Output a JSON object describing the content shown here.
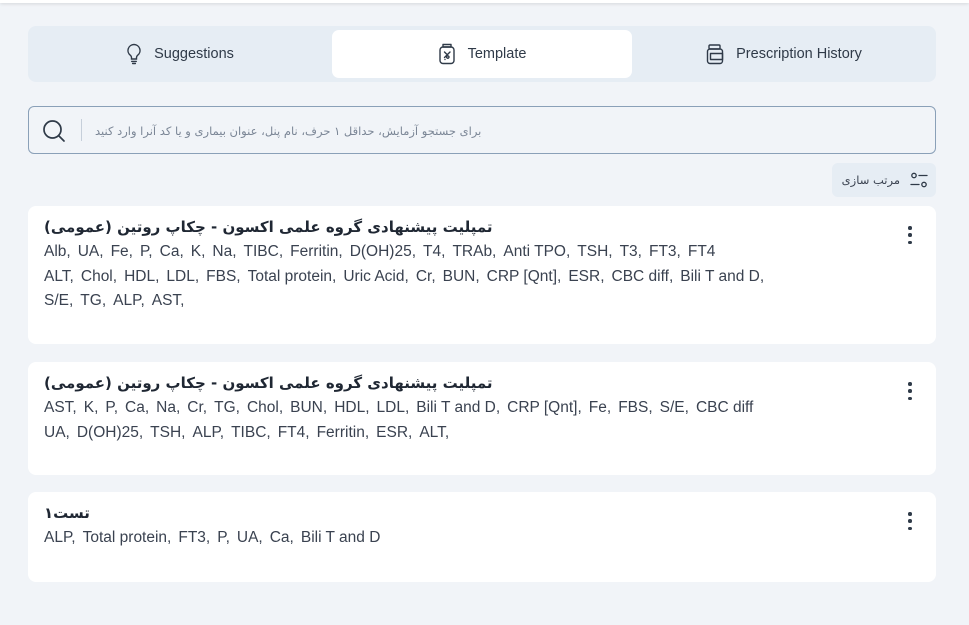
{
  "tabs": [
    {
      "label": "Suggestions",
      "icon": "lightbulb-icon",
      "active": false
    },
    {
      "label": "Template",
      "icon": "template-jar-icon",
      "active": true
    },
    {
      "label": "Prescription History",
      "icon": "prescription-bottle-icon",
      "active": false
    }
  ],
  "search": {
    "placeholder": "برای جستجو آزمایش، حداقل ۱ حرف، نام پنل، عنوان بیماری و یا کد آنرا وارد کنید",
    "value": "",
    "icon": "search-icon"
  },
  "sort": {
    "label": "مرتب سازی",
    "icon": "sort-sliders-icon"
  },
  "templates": [
    {
      "title": "تمپلیت پیشنهادی گروه علمی اکسون - چکاپ روتین (عمومی)",
      "tests": [
        "Alb,",
        "UA,",
        "Fe,",
        "P,",
        "Ca,",
        "K,",
        "Na,",
        "TIBC,",
        "Ferritin,",
        "D(OH)25,",
        "T4,",
        "TRAb,",
        "Anti TPO,",
        "TSH,",
        "T3,",
        "FT3,",
        "FT4",
        "ALT,",
        "Chol,",
        "HDL,",
        "LDL,",
        "FBS,",
        "Total protein,",
        "Uric Acid,",
        "Cr,",
        "BUN,",
        "CRP [Qnt],",
        "ESR,",
        "CBC diff,",
        "Bili T and D,",
        "S/E,",
        "TG,",
        "ALP,",
        "AST,"
      ]
    },
    {
      "title": "تمپلیت پیشنهادی گروه علمی اکسون - چکاپ روتین (عمومی)",
      "tests": [
        "AST,",
        "K,",
        "P,",
        "Ca,",
        "Na,",
        "Cr,",
        "TG,",
        "Chol,",
        "BUN,",
        "HDL,",
        "LDL,",
        "Bili T and D,",
        "CRP [Qnt],",
        "Fe,",
        "FBS,",
        "S/E,",
        "CBC diff",
        "UA,",
        "D(OH)25,",
        "TSH,",
        "ALP,",
        "TIBC,",
        "FT4,",
        "Ferritin,",
        "ESR,",
        "ALT,"
      ]
    },
    {
      "title": "تست۱",
      "tests": [
        "ALP,",
        "Total protein,",
        "FT3,",
        "P,",
        "UA,",
        "Ca,",
        "Bili T and D"
      ]
    }
  ],
  "colors": {
    "background": "#f1f4f8",
    "tab_bar": "#e6edf4",
    "card": "#ffffff",
    "search_border": "#8aa0b8",
    "text": "#3a4250"
  }
}
